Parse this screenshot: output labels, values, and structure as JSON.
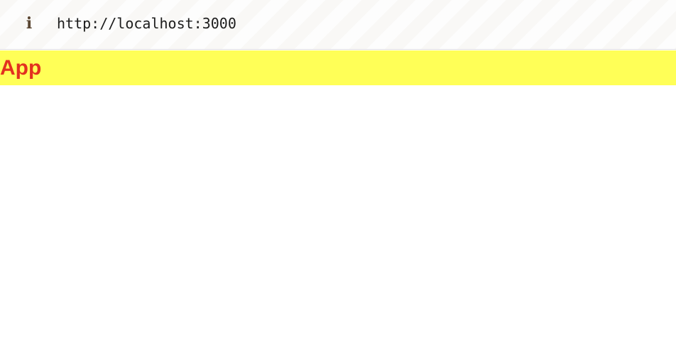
{
  "browser": {
    "url": "http://localhost:3000",
    "info_icon": "info-icon"
  },
  "app": {
    "title": "App",
    "banner_color": "#ffff57",
    "title_color": "#e3311f"
  }
}
